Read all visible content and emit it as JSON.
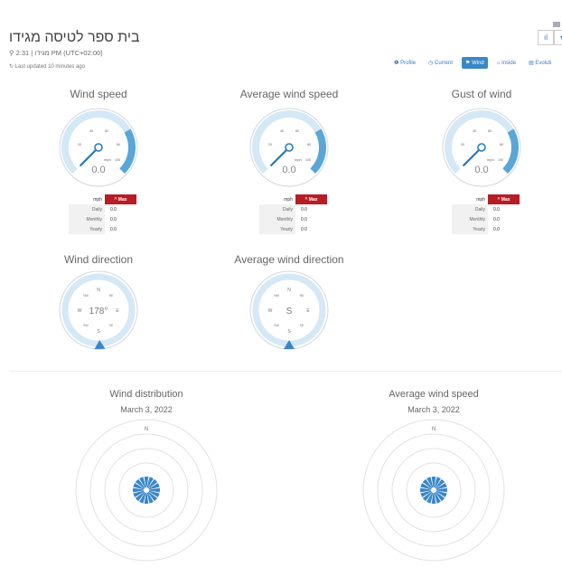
{
  "header": {
    "title": "בית ספר לטיסה מגידו",
    "subtitle": "2:31 | מגידו PM (UTC+02:00)",
    "updated": "Last updated 10 minutes ago"
  },
  "tabs": [
    {
      "label": "Profile",
      "icon": "info-icon",
      "active": false
    },
    {
      "label": "Current",
      "icon": "clock-icon",
      "active": false
    },
    {
      "label": "Wind",
      "icon": "flag-icon",
      "active": true
    },
    {
      "label": "Inside",
      "icon": "home-icon",
      "active": false
    },
    {
      "label": "Evoluti",
      "icon": "chart-icon",
      "active": false
    }
  ],
  "gauges": [
    {
      "title": "Wind speed",
      "value": "0.0",
      "unit": "mph",
      "ticks": [
        "20",
        "40",
        "60",
        "80",
        "100"
      ]
    },
    {
      "title": "Average wind speed",
      "value": "0.0",
      "unit": "mph",
      "ticks": [
        "20",
        "40",
        "60",
        "80",
        "100"
      ]
    },
    {
      "title": "Gust of wind",
      "value": "0.0",
      "unit": "mph",
      "ticks": [
        "20",
        "40",
        "60",
        "80",
        "100"
      ]
    }
  ],
  "stats_header": {
    "unit": "mph",
    "max": "Max"
  },
  "stats_rows": [
    {
      "label": "Daily",
      "value": "0.0"
    },
    {
      "label": "Monthly",
      "value": "0.0"
    },
    {
      "label": "Yearly",
      "value": "0.0"
    }
  ],
  "compasses": [
    {
      "title": "Wind direction",
      "center": "178°",
      "degrees": 178
    },
    {
      "title": "Average wind direction",
      "center": "S",
      "degrees": 180
    }
  ],
  "compass_labels": {
    "n": "N",
    "ne": "NE",
    "e": "E",
    "se": "SE",
    "s": "S",
    "sw": "SW",
    "w": "W",
    "nw": "NW"
  },
  "distributions": [
    {
      "title": "Wind distribution",
      "date": "March 3, 2022",
      "north": "N"
    },
    {
      "title": "Average wind speed",
      "date": "March 3, 2022",
      "north": "N"
    }
  ],
  "colors": {
    "accent": "#3a87c8",
    "gauge_light": "#d4e8f5",
    "gauge_dark": "#5aa6d6",
    "max_red": "#b81c24"
  }
}
